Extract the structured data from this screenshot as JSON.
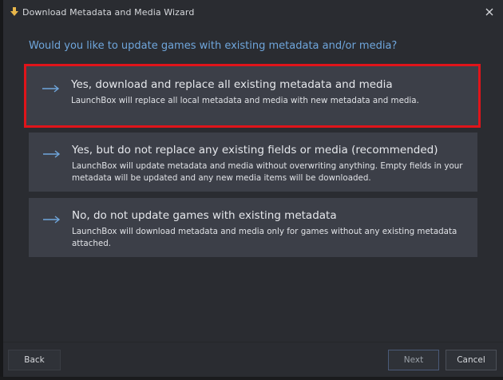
{
  "window": {
    "title": "Download Metadata and Media Wizard"
  },
  "question": "Would you like to update games with existing metadata and/or media?",
  "options": [
    {
      "title": "Yes, download and replace all existing metadata and media",
      "description": "LaunchBox will replace all local metadata and media with new metadata and media.",
      "selected": true
    },
    {
      "title": "Yes, but do not replace any existing fields or media (recommended)",
      "description": "LaunchBox will update metadata and media without overwriting anything. Empty fields in your metadata will be updated and any new media items will be downloaded.",
      "selected": false
    },
    {
      "title": "No, do not update games with existing metadata",
      "description": "LaunchBox will download metadata and media only for games without any existing metadata attached.",
      "selected": false
    }
  ],
  "buttons": {
    "back": "Back",
    "next": "Next",
    "cancel": "Cancel"
  },
  "icons": {
    "app": "download-arrow-icon",
    "close": "close-icon",
    "option_arrow": "right-arrow-icon"
  },
  "colors": {
    "accent_blue": "#6fa6dc",
    "selection_red": "#e0141a",
    "option_bg": "#3c3f48",
    "window_bg": "#2a2c31"
  }
}
